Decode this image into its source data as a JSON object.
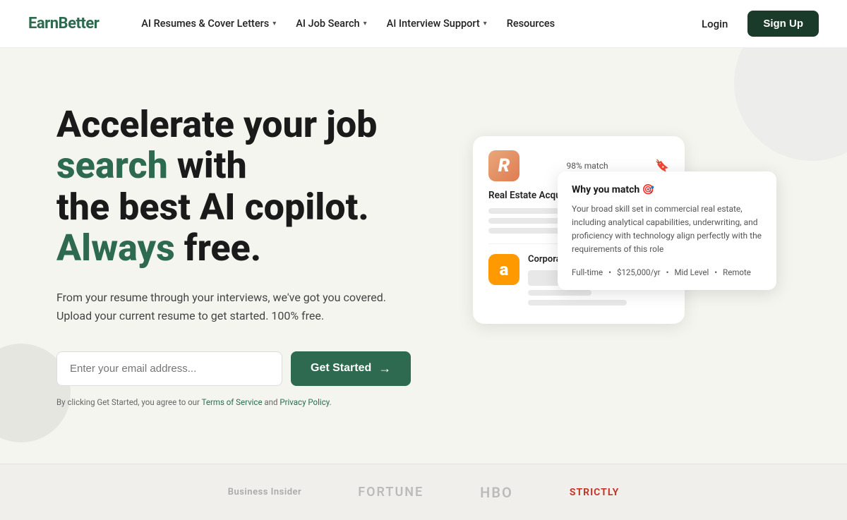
{
  "nav": {
    "logo": "EarnBetter",
    "items": [
      {
        "label": "AI Resumes & Cover Letters",
        "has_dropdown": true
      },
      {
        "label": "AI Job Search",
        "has_dropdown": true
      },
      {
        "label": "AI Interview Support",
        "has_dropdown": true
      },
      {
        "label": "Resources",
        "has_dropdown": false
      }
    ],
    "login_label": "Login",
    "signup_label": "Sign Up"
  },
  "hero": {
    "title_line1_regular": "Accelerate",
    "title_line1_regular2": "your",
    "title_line1_regular3": "job",
    "title_line1_green": "search",
    "title_line1_regular4": "with",
    "title_line2_regular": "the best AI copilot.",
    "title_line2_green": "Always",
    "title_line2_regular2": "free.",
    "subtitle": "From your resume through your interviews, we've got you covered. Upload your current resume to get started. 100% free.",
    "email_placeholder": "Enter your email address...",
    "cta_label": "Get Started",
    "terms_prefix": "By clicking Get Started, you agree to our ",
    "terms_link1": "Terms of Service",
    "terms_and": " and ",
    "terms_link2": "Privacy Policy",
    "terms_suffix": "."
  },
  "job_card": {
    "match_percent_1": "98% match",
    "job_title_1": "Real Estate Acquisition Analyst",
    "company_1_letter": "R",
    "job_title_2": "Corporate Real",
    "company_2_letter": "a"
  },
  "tooltip": {
    "title": "Why you match 🎯",
    "body": "Your broad skill set in commercial real estate, including analytical capabilities, underwriting, and proficiency with technology align perfectly with the requirements of this role",
    "tag_fulltime": "Full-time",
    "tag_salary": "$125,000/yr",
    "tag_level": "Mid Level",
    "tag_location": "Remote"
  },
  "footer": {
    "logos": [
      "Business Insider",
      "FORTUNE",
      "HBO",
      "STRICTLY"
    ]
  }
}
